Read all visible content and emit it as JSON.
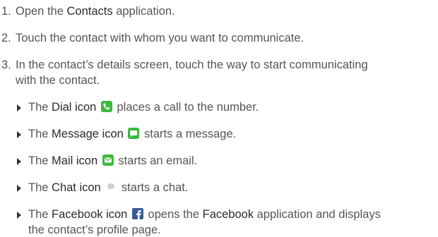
{
  "steps": [
    {
      "num": "1.",
      "pre": "Open the ",
      "bold": "Contacts",
      "post": " application."
    },
    {
      "num": "2.",
      "text": "Touch the contact with whom you want to communicate."
    },
    {
      "num": "3.",
      "line1": "In the contact’s details screen, touch the way to start communicating",
      "line2": "with the contact."
    }
  ],
  "bullets": [
    {
      "pre": "The ",
      "bold": "Dial icon",
      "post": " places a call to the number.",
      "icon": "phone-icon"
    },
    {
      "pre": "The ",
      "bold": "Message icon",
      "post": " starts a message.",
      "icon": "message-icon"
    },
    {
      "pre": "The ",
      "bold": "Mail icon",
      "post": " starts an email.",
      "icon": "mail-icon"
    },
    {
      "pre": "The ",
      "bold": "Chat icon",
      "post": " starts a chat.",
      "icon": "chat-icon"
    },
    {
      "pre": "The ",
      "bold": "Facebook icon",
      "mid": " opens the ",
      "bold2": "Facebook",
      "post": " application and displays",
      "line2": "the contact’s profile page.",
      "icon": "facebook-icon"
    }
  ],
  "colors": {
    "text": "#555555",
    "emphasis": "#2b2b2b",
    "icon_green": "#3cb83c",
    "icon_blue": "#3b5998"
  }
}
